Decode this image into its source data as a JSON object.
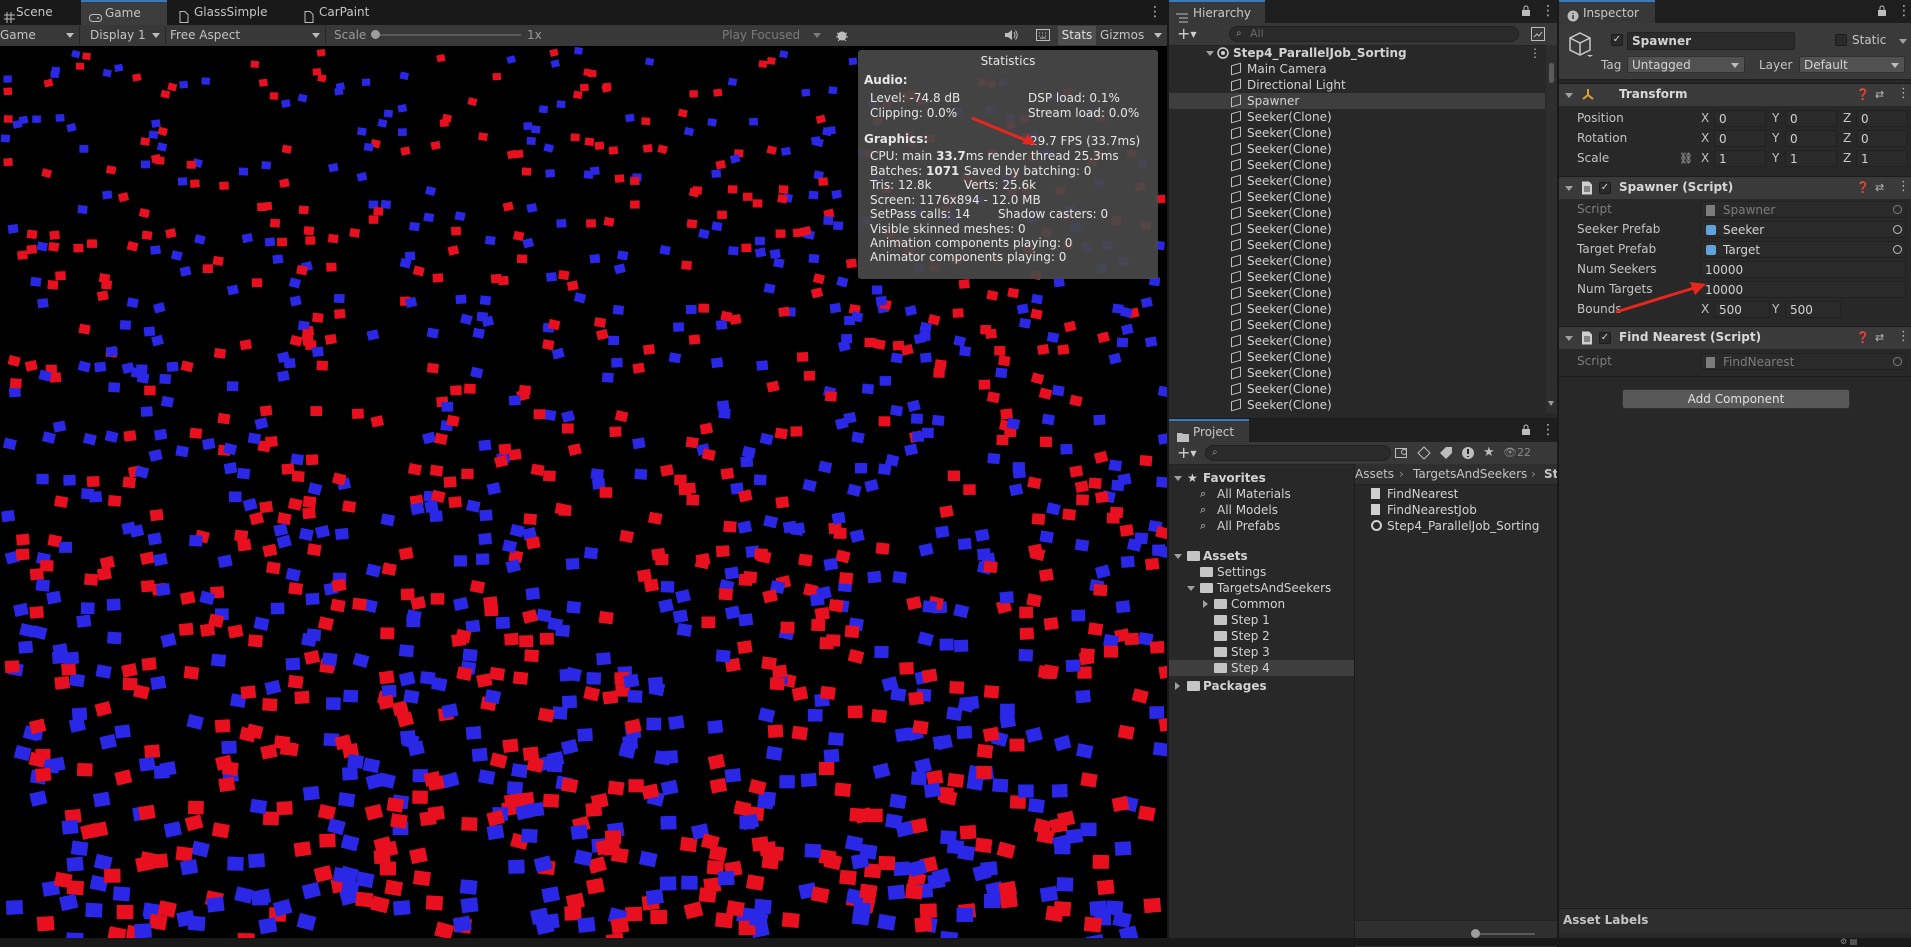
{
  "game_window": {
    "tabs": [
      {
        "label": "Scene",
        "icon": "grid-icon"
      },
      {
        "label": "Game",
        "icon": "gamepad-icon"
      },
      {
        "label": "GlassSimple",
        "icon": "file-icon"
      },
      {
        "label": "CarPaint",
        "icon": "file-icon"
      }
    ],
    "toolbar": {
      "view_dropdown": "Game",
      "display_dropdown": "Display 1",
      "aspect_dropdown": "Free Aspect",
      "scale_label": "Scale",
      "scale_value": "1x",
      "scale_level": 0.0,
      "play_mode_dropdown": "Play Focused",
      "stats_button": "Stats",
      "gizmos_button": "Gizmos"
    },
    "statistics": {
      "title": "Statistics",
      "audio_heading": "Audio:",
      "audio_level": "Level: -74.8 dB",
      "audio_clipping": "Clipping: 0.0%",
      "dsp_load": "DSP load: 0.1%",
      "stream_load": "Stream load: 0.0%",
      "fps": "29.7 FPS (33.7ms)",
      "graphics_heading": "Graphics:",
      "cpu_prefix": "CPU: main",
      "cpu_main": "33.7",
      "cpu_suffix": "ms  render thread 25.3ms",
      "batches_prefix": "Batches:",
      "batches_value": "1071",
      "saved_batching": "Saved by batching: 0",
      "tris": "Tris: 12.8k",
      "verts": "Verts: 25.6k",
      "screen": "Screen: 1176x894 - 12.0 MB",
      "setpass": "SetPass calls: 14",
      "shadow_casters": "Shadow casters: 0",
      "skinned_meshes": "Visible skinned meshes: 0",
      "animation_components": "Animation components playing: 0",
      "animator_components": "Animator components playing: 0"
    },
    "colors": {
      "red_cube": "#e8101e",
      "blue_cube": "#2a28e6",
      "background": "#000000"
    }
  },
  "hierarchy": {
    "tab_label": "Hierarchy",
    "search_placeholder": "All",
    "scene_name": "Step4_ParallelJob_Sorting",
    "items": [
      "Main Camera",
      "Directional Light",
      "Spawner",
      "Seeker(Clone)",
      "Seeker(Clone)",
      "Seeker(Clone)",
      "Seeker(Clone)",
      "Seeker(Clone)",
      "Seeker(Clone)",
      "Seeker(Clone)",
      "Seeker(Clone)",
      "Seeker(Clone)",
      "Seeker(Clone)",
      "Seeker(Clone)",
      "Seeker(Clone)",
      "Seeker(Clone)",
      "Seeker(Clone)",
      "Seeker(Clone)",
      "Seeker(Clone)",
      "Seeker(Clone)",
      "Seeker(Clone)",
      "Seeker(Clone)",
      "Seeker(Clone)"
    ],
    "selected_item": "Spawner"
  },
  "project": {
    "tab_label": "Project",
    "hidden_count": "22",
    "favorites_label": "Favorites",
    "favorites": [
      "All Materials",
      "All Models",
      "All Prefabs"
    ],
    "assets_label": "Assets",
    "tree": [
      {
        "label": "Settings",
        "level": 1
      },
      {
        "label": "TargetsAndSeekers",
        "level": 1
      },
      {
        "label": "Common",
        "level": 2
      },
      {
        "label": "Step 1",
        "level": 2
      },
      {
        "label": "Step 2",
        "level": 2
      },
      {
        "label": "Step 3",
        "level": 2
      },
      {
        "label": "Step 4",
        "level": 2
      }
    ],
    "packages_label": "Packages",
    "breadcrumb": [
      "Assets",
      "TargetsAndSeekers",
      "St"
    ],
    "files": [
      {
        "label": "FindNearest",
        "icon": "script-icon"
      },
      {
        "label": "FindNearestJob",
        "icon": "script-icon"
      },
      {
        "label": "Step4_ParallelJob_Sorting",
        "icon": "unity-scene-icon"
      }
    ]
  },
  "inspector": {
    "tab_label": "Inspector",
    "object_name": "Spawner",
    "static_label": "Static",
    "tag_label": "Tag",
    "tag_value": "Untagged",
    "layer_label": "Layer",
    "layer_value": "Default",
    "transform": {
      "title": "Transform",
      "position_label": "Position",
      "rotation_label": "Rotation",
      "scale_label": "Scale",
      "position": [
        "0",
        "0",
        "0"
      ],
      "rotation": [
        "0",
        "0",
        "0"
      ],
      "scale": [
        "1",
        "1",
        "1"
      ]
    },
    "spawner_script": {
      "title": "Spawner (Script)",
      "script_label": "Script",
      "script_value": "Spawner",
      "seeker_prefab_label": "Seeker Prefab",
      "seeker_prefab_value": "Seeker",
      "target_prefab_label": "Target Prefab",
      "target_prefab_value": "Target",
      "num_seekers_label": "Num Seekers",
      "num_seekers_value": "10000",
      "num_targets_label": "Num Targets",
      "num_targets_value": "10000",
      "bounds_label": "Bounds",
      "bounds_x": "500",
      "bounds_y": "500"
    },
    "find_nearest_script": {
      "title": "Find Nearest (Script)",
      "script_label": "Script",
      "script_value": "FindNearest"
    },
    "add_component_label": "Add Component",
    "asset_labels_label": "Asset Labels",
    "axis_labels": [
      "X",
      "Y",
      "Z"
    ]
  },
  "annotations": {
    "arrow_color": "#e8261e"
  }
}
